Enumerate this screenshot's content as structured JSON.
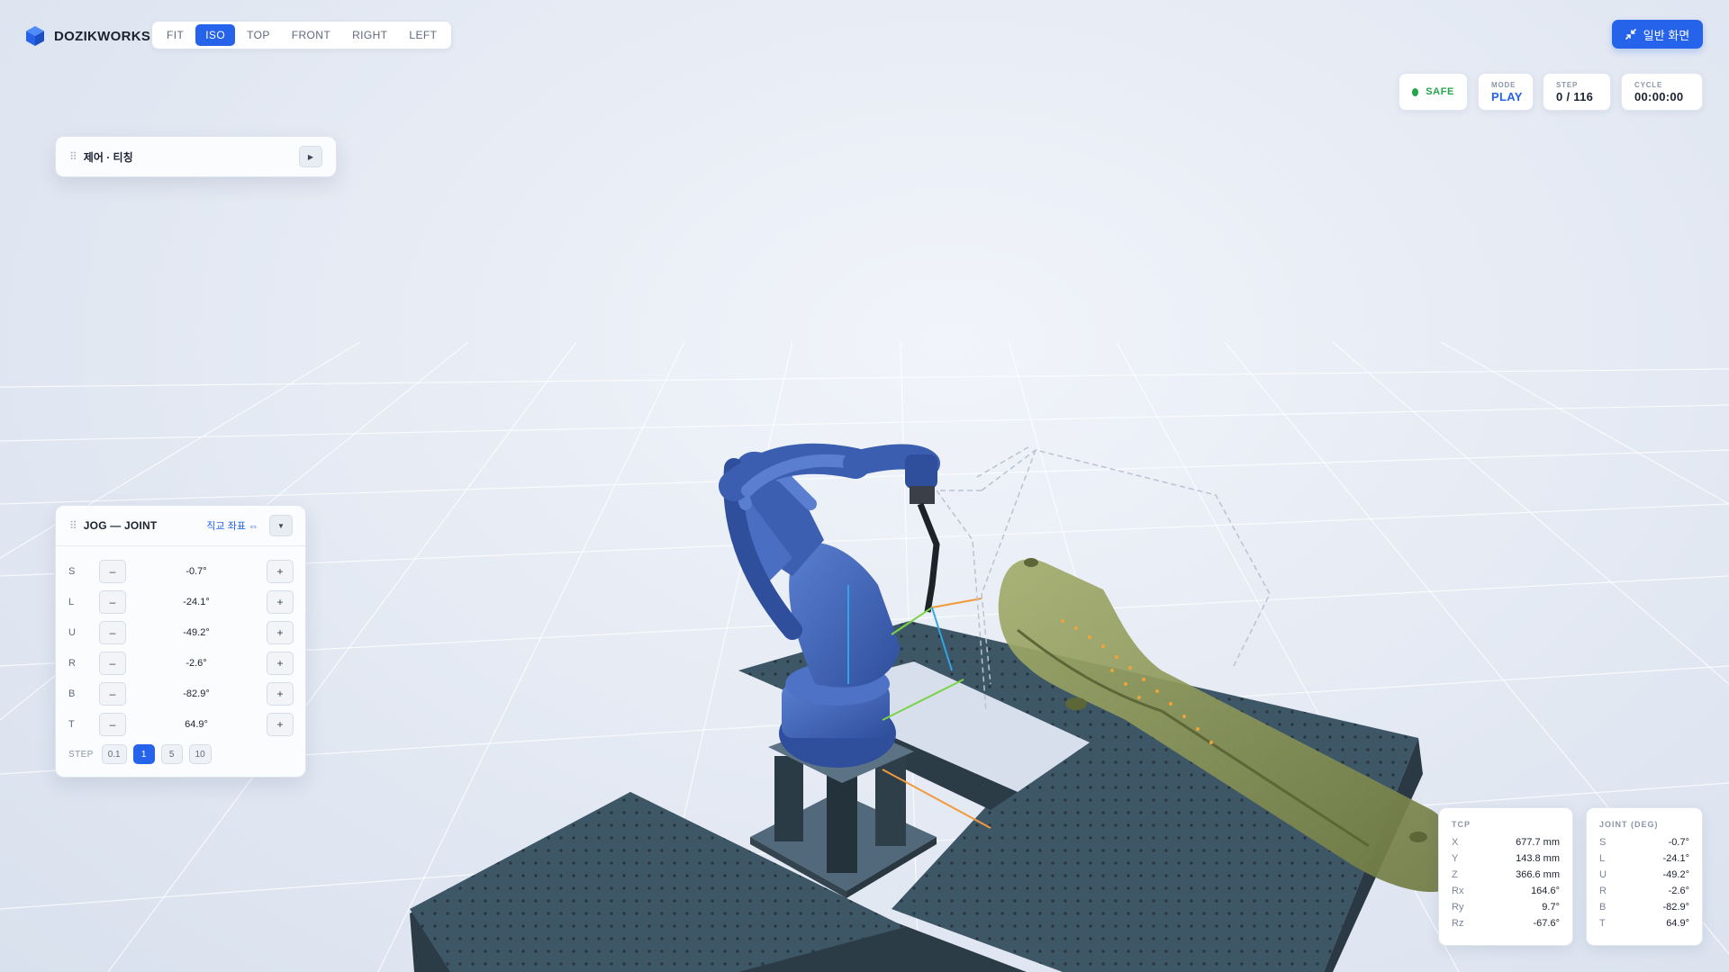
{
  "app": {
    "brand": "DOZIKWORKS"
  },
  "views": [
    {
      "label": "FIT",
      "active": false
    },
    {
      "label": "ISO",
      "active": true
    },
    {
      "label": "TOP",
      "active": false
    },
    {
      "label": "FRONT",
      "active": false
    },
    {
      "label": "RIGHT",
      "active": false
    },
    {
      "label": "LEFT",
      "active": false
    }
  ],
  "normal_view_button": "일반 화면",
  "status": {
    "safe": "SAFE",
    "mode_label": "MODE",
    "mode_value": "PLAY",
    "step_label": "STEP",
    "step_value": "0 / 116",
    "cycle_label": "CYCLE",
    "cycle_value": "00:00:00"
  },
  "control_panel": {
    "title": "제어 · 티칭"
  },
  "jog": {
    "title": "JOG — JOINT",
    "coord_toggle": "직교 좌표 ⇔",
    "axes": [
      {
        "label": "S",
        "value": "-0.7°"
      },
      {
        "label": "L",
        "value": "-24.1°"
      },
      {
        "label": "U",
        "value": "-49.2°"
      },
      {
        "label": "R",
        "value": "-2.6°"
      },
      {
        "label": "B",
        "value": "-82.9°"
      },
      {
        "label": "T",
        "value": "64.9°"
      }
    ],
    "minus": "–",
    "plus": "+",
    "step_label": "STEP",
    "steps": [
      "0.1",
      "1",
      "5",
      "10"
    ],
    "active_step": "1"
  },
  "tcp": {
    "title": "TCP",
    "rows": [
      {
        "k": "X",
        "v": "677.7 mm"
      },
      {
        "k": "Y",
        "v": "143.8 mm"
      },
      {
        "k": "Z",
        "v": "366.6 mm"
      },
      {
        "k": "Rx",
        "v": "164.6°"
      },
      {
        "k": "Ry",
        "v": "9.7°"
      },
      {
        "k": "Rz",
        "v": "-67.6°"
      }
    ]
  },
  "joint": {
    "title": "JOINT (DEG)",
    "rows": [
      {
        "k": "S",
        "v": "-0.7°"
      },
      {
        "k": "L",
        "v": "-24.1°"
      },
      {
        "k": "U",
        "v": "-49.2°"
      },
      {
        "k": "R",
        "v": "-2.6°"
      },
      {
        "k": "B",
        "v": "-82.9°"
      },
      {
        "k": "T",
        "v": "64.9°"
      }
    ]
  },
  "colors": {
    "accent": "#2563eb",
    "safe": "#22a447",
    "robot": "#3e63b8",
    "table": "#3d5566",
    "workpiece": "#8a9556"
  }
}
